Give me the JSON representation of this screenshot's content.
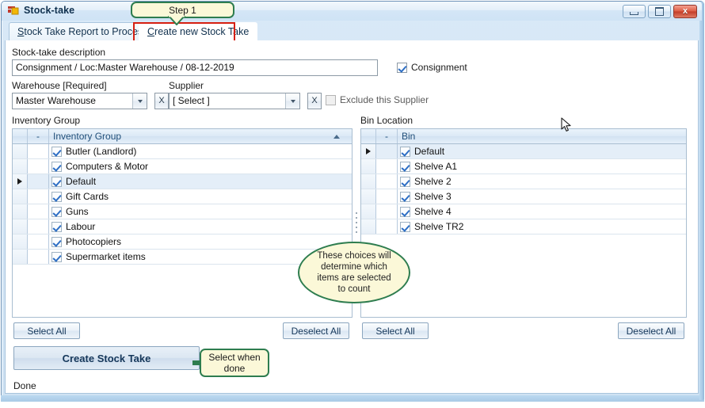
{
  "window": {
    "title": "Stock-take",
    "icon": "form-icon",
    "minimize_label": "Minimize",
    "maximize_label": "Maximize",
    "close_label": "Close"
  },
  "tabs": [
    {
      "label": "Stock Take Report to Process",
      "accel": "S",
      "rest": "tock Take Report to Process",
      "selected": false
    },
    {
      "label": "Create new Stock Take",
      "accel": "C",
      "rest": "reate new Stock Take",
      "selected": true
    }
  ],
  "form": {
    "description_label": "Stock-take description",
    "description_value": "Consignment / Loc:Master Warehouse / 08-12-2019",
    "consignment_checkbox_label": "Consignment",
    "consignment_checked": true,
    "warehouse_label": "Warehouse [Required]",
    "warehouse_value": "Master Warehouse",
    "warehouse_clear_label": "X",
    "supplier_label": "Supplier",
    "supplier_value": "[ Select ]",
    "supplier_clear_label": "X",
    "exclude_supplier_label": "Exclude this Supplier",
    "exclude_supplier_checked": false
  },
  "inventory_grid": {
    "caption": "Inventory Group",
    "columns": [
      "-",
      "Inventory Group"
    ],
    "sort_direction": "ascending",
    "rows": [
      {
        "label": "Butler (Landlord)",
        "checked": true,
        "current": false
      },
      {
        "label": "Computers & Motor",
        "checked": true,
        "current": false
      },
      {
        "label": "Default",
        "checked": true,
        "current": true
      },
      {
        "label": "Gift Cards",
        "checked": true,
        "current": false
      },
      {
        "label": "Guns",
        "checked": true,
        "current": false
      },
      {
        "label": "Labour",
        "checked": true,
        "current": false
      },
      {
        "label": "Photocopiers",
        "checked": true,
        "current": false
      },
      {
        "label": "Supermarket items",
        "checked": true,
        "current": false
      }
    ],
    "select_all_label": "Select All",
    "deselect_all_label": "Deselect All"
  },
  "bin_grid": {
    "caption": "Bin Location",
    "columns": [
      "-",
      "Bin"
    ],
    "rows": [
      {
        "label": "Default",
        "checked": true,
        "current": true
      },
      {
        "label": "Shelve A1",
        "checked": true,
        "current": false
      },
      {
        "label": "Shelve 2",
        "checked": true,
        "current": false
      },
      {
        "label": "Shelve 3",
        "checked": true,
        "current": false
      },
      {
        "label": "Shelve 4",
        "checked": true,
        "current": false
      },
      {
        "label": "Shelve TR2",
        "checked": true,
        "current": false
      }
    ],
    "select_all_label": "Select All",
    "deselect_all_label": "Deselect All"
  },
  "actions": {
    "create_stock_take_label": "Create Stock Take"
  },
  "status": {
    "text": "Done"
  },
  "annotations": {
    "step1": "Step 1",
    "ellipse_line1": "These choices will",
    "ellipse_line2": "determine which",
    "ellipse_line3": "items are selected",
    "ellipse_line4": "to count",
    "select_when_done_line1": "Select when",
    "select_when_done_line2": "done"
  },
  "colors": {
    "annotation_border": "#2e7d4f",
    "annotation_fill": "#fbf8d8",
    "highlight_border": "#d61f11",
    "title_text": "#10314f",
    "grid_header_text": "#1f4e79",
    "close_button": "#c23c27"
  }
}
